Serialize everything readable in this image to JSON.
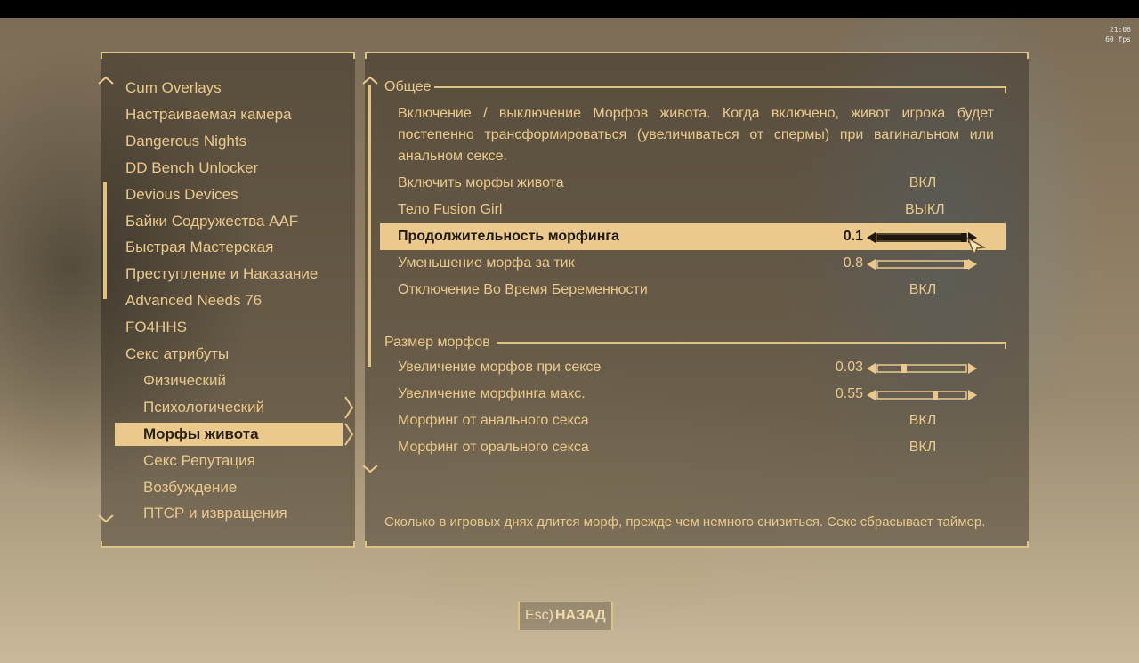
{
  "hud": {
    "time": "21:06",
    "fps": "60 fps"
  },
  "menu": {
    "items": [
      {
        "label": "Cum Overlays",
        "level": "top"
      },
      {
        "label": "Настраиваемая камера",
        "level": "top"
      },
      {
        "label": "Dangerous Nights",
        "level": "top"
      },
      {
        "label": "DD Bench Unlocker",
        "level": "top"
      },
      {
        "label": "Devious Devices",
        "level": "top"
      },
      {
        "label": "Байки Содружества AAF",
        "level": "top"
      },
      {
        "label": "Быстрая Мастерская",
        "level": "top"
      },
      {
        "label": "Преступление и Наказание",
        "level": "top"
      },
      {
        "label": "Advanced Needs 76",
        "level": "top"
      },
      {
        "label": "FO4HHS",
        "level": "top"
      },
      {
        "label": "Секс атрибуты",
        "level": "top"
      },
      {
        "label": "Физический",
        "level": "sub"
      },
      {
        "label": "Психологический",
        "level": "sub"
      },
      {
        "label": "Морфы живота",
        "level": "sub",
        "selected": true
      },
      {
        "label": "Секс Репутация",
        "level": "sub"
      },
      {
        "label": "Возбуждение",
        "level": "sub"
      },
      {
        "label": "ПТСР и извращения",
        "level": "sub"
      }
    ]
  },
  "content": {
    "section_general": "Общее",
    "description": "Включение / выключение Морфов живота. Когда включено, живот игрока будет постепенно трансформироваться (увеличиваться от спермы) при вагинальном или анальном сексе.",
    "general_rows": [
      {
        "label": "Включить морфы живота",
        "value": "ВКЛ",
        "type": "toggle"
      },
      {
        "label": "Тело Fusion Girl",
        "value": "ВЫКЛ",
        "type": "toggle"
      },
      {
        "label": "Продолжительность морфинга",
        "value": "0.1",
        "type": "slider",
        "level": 0.97,
        "selected": true
      },
      {
        "label": "Уменьшение морфа за тик",
        "value": "0.8",
        "type": "slider",
        "level": 1.0
      },
      {
        "label": "Отключение Во Время Беременности",
        "value": "ВКЛ",
        "type": "toggle"
      }
    ],
    "section_size": "Размер морфов",
    "size_rows": [
      {
        "label": "Увеличение морфов при сексе",
        "value": "0.03",
        "type": "slider",
        "level": 0.3
      },
      {
        "label": "Увеличение морфинга макс.",
        "value": "0.55",
        "type": "slider",
        "level": 0.65
      },
      {
        "label": "Морфинг от анального секса",
        "value": "ВКЛ",
        "type": "toggle"
      },
      {
        "label": "Морфинг от орального секса",
        "value": "ВКЛ",
        "type": "toggle"
      }
    ],
    "hint": "Сколько в игровых днях длится морф, прежде чем немного снизиться. Секс сбрасывает таймер."
  },
  "footer": {
    "back_key": "Esc)",
    "back_label": "НАЗАД"
  },
  "colors": {
    "accent": "#ebc98c",
    "selected_text": "#1e180f"
  },
  "icons": [
    "scroll-up-icon",
    "scroll-down-icon",
    "chevron-right-icon",
    "slider-arrow-left-icon",
    "slider-arrow-right-icon",
    "mouse-cursor-icon"
  ]
}
